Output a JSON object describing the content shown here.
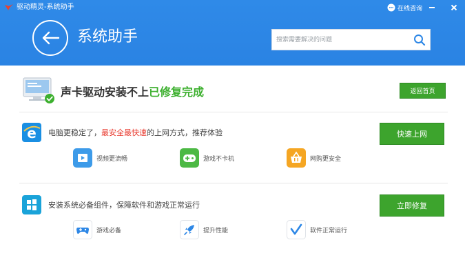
{
  "window": {
    "title": "驱动精灵-系统助手",
    "online_consult": "在线咨询",
    "minimize": "–",
    "close": "×"
  },
  "header": {
    "page_title": "系统助手",
    "search_placeholder": "搜索需要解决的问题"
  },
  "status": {
    "text_main": "声卡驱动安装不上",
    "text_done": "已修复完成",
    "button": "返回首页"
  },
  "browser_row": {
    "text_before": "电脑更稳定了，",
    "text_highlight": "最安全最快速",
    "text_after": "的上网方式，推荐体验",
    "button": "快速上网",
    "features": [
      {
        "label": "视频更流畅",
        "icon": "video-icon",
        "color": "#3d9be9"
      },
      {
        "label": "游戏不卡机",
        "icon": "gamepad-icon",
        "color": "#4cb944"
      },
      {
        "label": "网购更安全",
        "icon": "basket-icon",
        "color": "#f5a623"
      }
    ]
  },
  "repair_row": {
    "text": "安装系统必备组件，保障软件和游戏正常运行",
    "button": "立即修复",
    "features": [
      {
        "label": "游戏必备",
        "icon": "gamepad-icon"
      },
      {
        "label": "提升性能",
        "icon": "rocket-icon"
      },
      {
        "label": "软件正常运行",
        "icon": "check-icon"
      }
    ]
  },
  "colors": {
    "header_blue": "#2d87e6",
    "button_green": "#3da42d",
    "success_green": "#3db02f",
    "highlight_red": "#e8362a"
  }
}
